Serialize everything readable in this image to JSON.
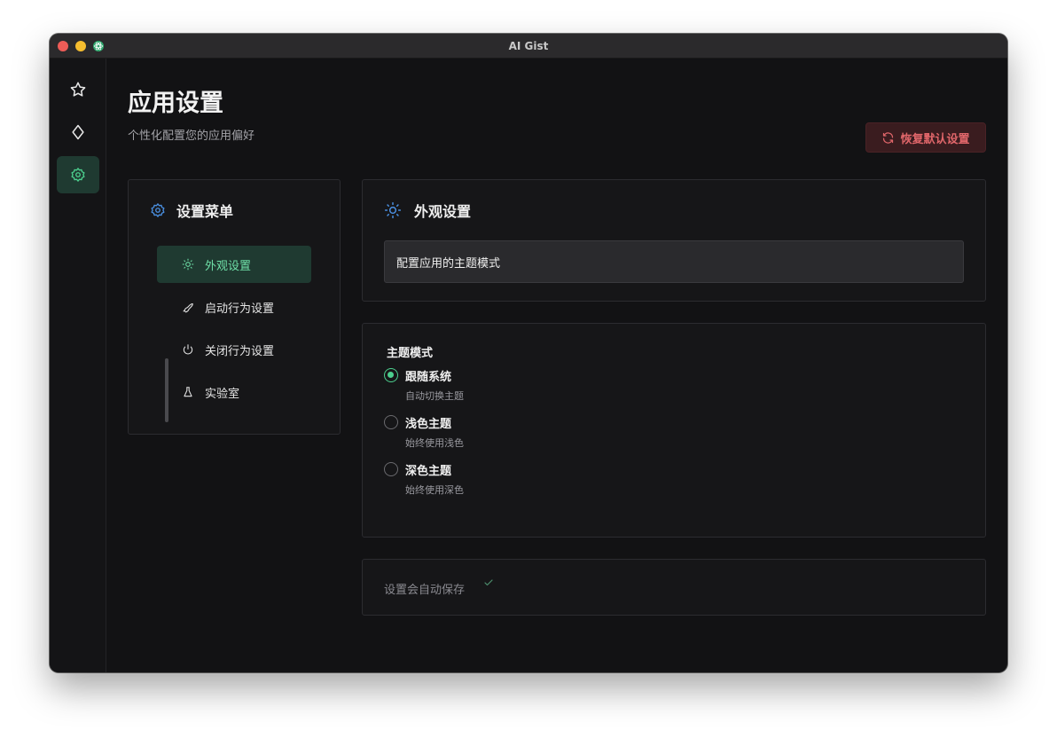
{
  "window": {
    "title": "AI Gist"
  },
  "rail": {
    "items": [
      {
        "icon": "star-icon",
        "active": false
      },
      {
        "icon": "diamond-icon",
        "active": false
      },
      {
        "icon": "gear-icon",
        "active": true
      }
    ]
  },
  "header": {
    "title": "应用设置",
    "subtitle": "个性化配置您的应用偏好",
    "reset_label": "恢复默认设置"
  },
  "menu": {
    "title": "设置菜单",
    "items": [
      {
        "label": "外观设置",
        "icon": "sun-icon",
        "active": true
      },
      {
        "label": "启动行为设置",
        "icon": "rocket-icon",
        "active": false
      },
      {
        "label": "关闭行为设置",
        "icon": "power-icon",
        "active": false
      },
      {
        "label": "实验室",
        "icon": "flask-icon",
        "active": false
      }
    ]
  },
  "appearance": {
    "title": "外观设置",
    "description": "配置应用的主题模式"
  },
  "theme": {
    "label": "主题模式",
    "options": [
      {
        "label": "跟随系统",
        "desc": "自动切换主题",
        "selected": true
      },
      {
        "label": "浅色主题",
        "desc": "始终使用浅色",
        "selected": false
      },
      {
        "label": "深色主题",
        "desc": "始终使用深色",
        "selected": false
      }
    ]
  },
  "autosave": {
    "text": "设置会自动保存"
  },
  "colors": {
    "accent": "#4ccf8e",
    "accent_bg": "#1f3a31",
    "danger": "#e0666a",
    "danger_bg": "#3a1c1f",
    "icon_blue": "#4a8fe0"
  }
}
